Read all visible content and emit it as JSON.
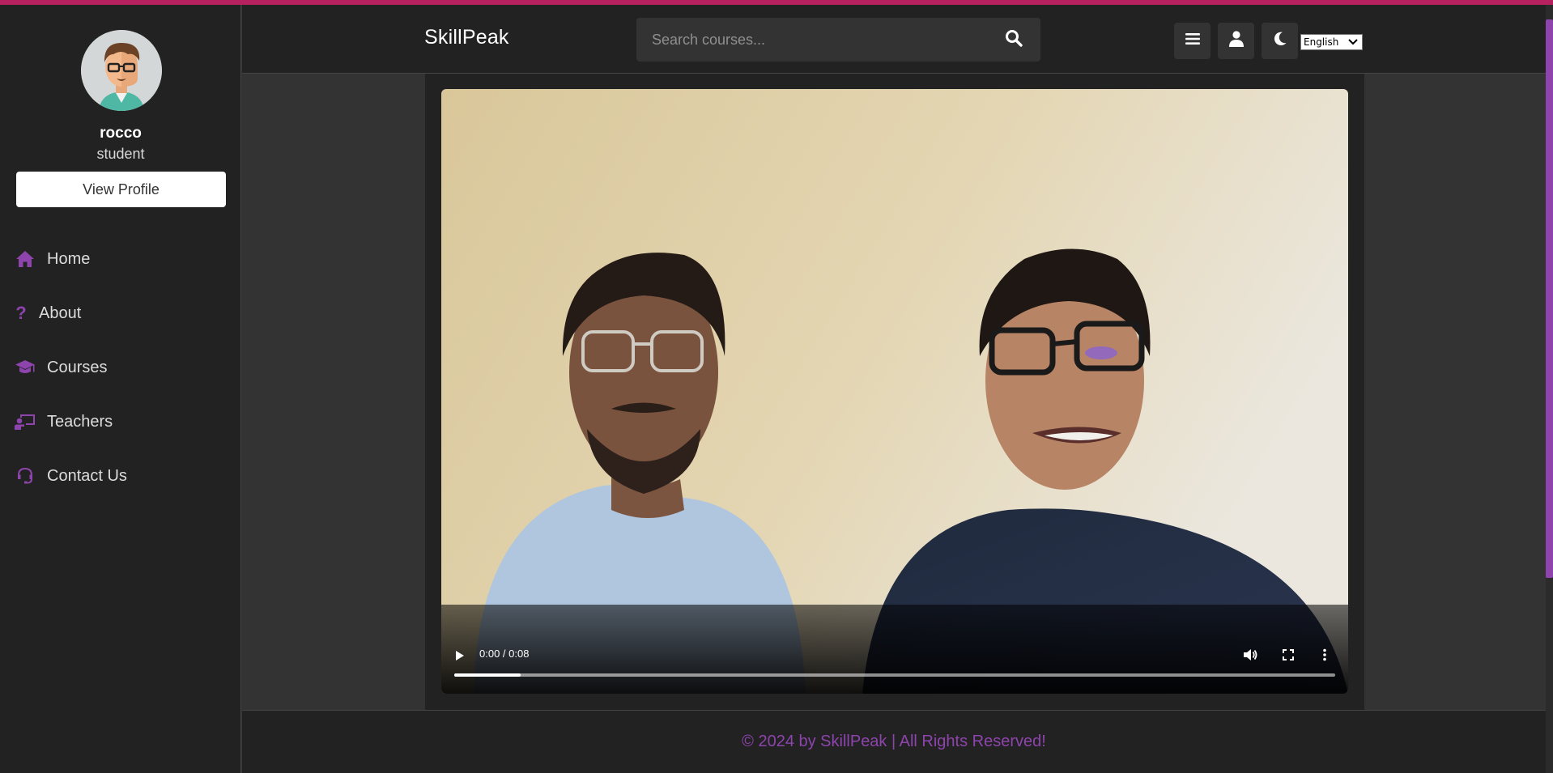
{
  "theme": {
    "accent": "#8e44ad",
    "top_stripe": "#b8215f",
    "panel": "#222222",
    "background": "#333333"
  },
  "sidebar": {
    "avatar_icon": "cartoon-man-with-glasses",
    "username": "rocco",
    "role": "student",
    "view_profile_label": "View Profile",
    "nav": [
      {
        "label": "Home",
        "icon": "home-icon"
      },
      {
        "label": "About",
        "icon": "question-icon"
      },
      {
        "label": "Courses",
        "icon": "graduation-cap-icon"
      },
      {
        "label": "Teachers",
        "icon": "chalkboard-teacher-icon"
      },
      {
        "label": "Contact Us",
        "icon": "headset-icon"
      }
    ]
  },
  "header": {
    "logo": "SkillPeak",
    "search": {
      "placeholder": "Search courses...",
      "value": "",
      "icon": "search-icon"
    },
    "buttons": [
      "menu-icon",
      "user-icon",
      "moon-icon"
    ],
    "language": "English"
  },
  "video": {
    "time": "0:00 / 0:08",
    "progress_buffered": 0.075,
    "controls": [
      "play-icon",
      "volume-icon",
      "fullscreen-icon",
      "more-options-icon"
    ]
  },
  "footer": {
    "text": "© 2024 by SkillPeak | All Rights Reserved!"
  }
}
